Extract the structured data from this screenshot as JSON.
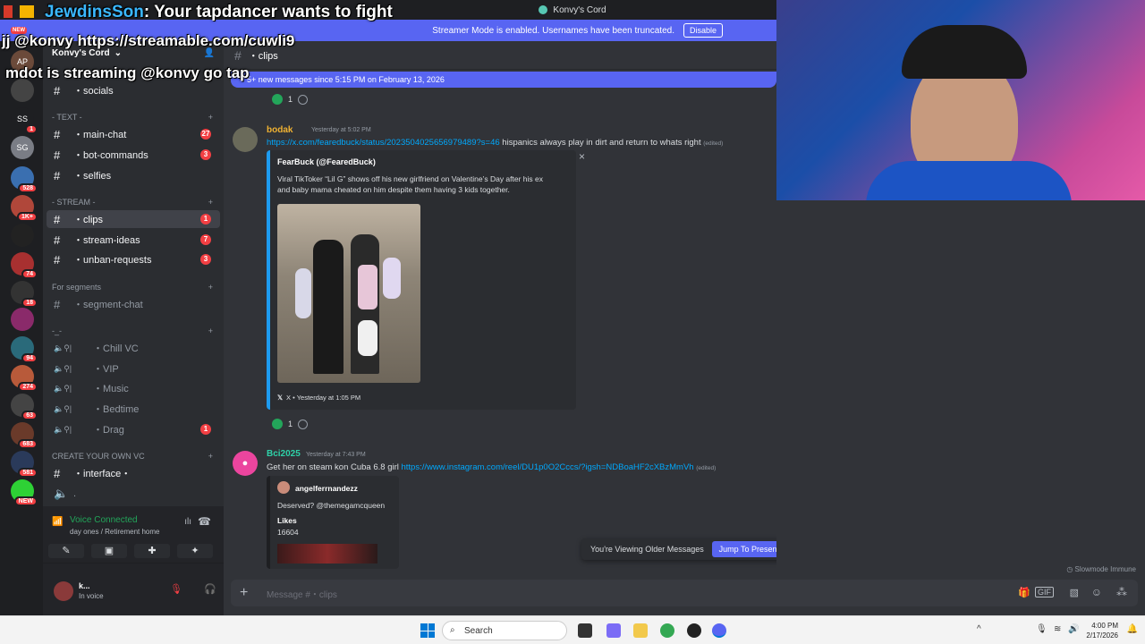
{
  "window": {
    "title": "Konvy's Cord"
  },
  "streamer": {
    "text": "Streamer Mode is enabled. Usernames have been truncated.",
    "disable": "Disable"
  },
  "overlay": {
    "line1_user": "JewdinsSon",
    "line1_text": ": Your tapdancer wants to fight",
    "line2": "jj @konvy https://streamable.com/cuwli9",
    "line3": "mdot is streaming @konvy go tap",
    "new_badge": "NEW"
  },
  "rail": {
    "servers": [
      {
        "label": "AP",
        "color": "#6b4a3a",
        "badge": ""
      },
      {
        "label": "",
        "color": "#444",
        "badge": ""
      },
      {
        "label": "SS",
        "color": "#1e1f22",
        "badge": "1"
      },
      {
        "label": "SG",
        "color": "#7a7d85",
        "badge": ""
      },
      {
        "label": "",
        "color": "#3a6fb0",
        "badge": "528"
      },
      {
        "label": "",
        "color": "#b0473a",
        "badge": "1K+"
      },
      {
        "label": "",
        "color": "#222",
        "badge": ""
      },
      {
        "label": "",
        "color": "#a83030",
        "badge": "74"
      },
      {
        "label": "",
        "color": "#333",
        "badge": "18"
      },
      {
        "label": "",
        "color": "#8a2a6a",
        "badge": ""
      },
      {
        "label": "",
        "color": "#2a6a7a",
        "badge": "94"
      },
      {
        "label": "",
        "color": "#b85a3a",
        "badge": "274"
      },
      {
        "label": "",
        "color": "#444",
        "badge": "63"
      },
      {
        "label": "",
        "color": "#6a3a2a",
        "badge": "683"
      },
      {
        "label": "",
        "color": "#2a3a5a",
        "badge": "581"
      },
      {
        "label": "",
        "color": "#2ed135",
        "badge": "NEW"
      }
    ]
  },
  "sidebar": {
    "server_name": "Konvy's Cord",
    "top_channel": "・socials",
    "cat_text": "- TEXT -",
    "cat_stream": "- STREAM -",
    "cat_segments": "For segments",
    "cat_voice": "-_-",
    "cat_create": "CREATE YOUR OWN VC",
    "channels": [
      {
        "name": "・main-chat",
        "count": "27"
      },
      {
        "name": "・bot-commands",
        "count": "3"
      },
      {
        "name": "・selfies",
        "count": ""
      },
      {
        "name": "・clips",
        "count": "1"
      },
      {
        "name": "・stream-ideas",
        "count": "7"
      },
      {
        "name": "・unban-requests",
        "count": "3"
      },
      {
        "name": "・segment-chat",
        "count": ""
      }
    ],
    "voice": [
      {
        "name": "・Chill VC",
        "count": ""
      },
      {
        "name": "・VIP",
        "count": ""
      },
      {
        "name": "・Music",
        "count": ""
      },
      {
        "name": "・Bedtime",
        "count": ""
      },
      {
        "name": "・Drag",
        "count": "1"
      }
    ],
    "interface": "・interface・",
    "last": ".",
    "voice_connected": "Voice Connected",
    "voice_sub": "day ones / Retirement home",
    "user_name": "k...",
    "user_status": "In voice"
  },
  "main": {
    "channel": "・clips",
    "new_messages": "5+ new messages since 5:15 PM on February 13, 2026",
    "reaction_count": "1",
    "msg1": {
      "author": "bodak",
      "author_color": "#f0b232",
      "ts": "Yesterday at 5:02 PM",
      "link": "https://x.com/fearedbuck/status/2023504025656979489?s=46",
      "text": " hispanics always play in dirt and return to whats right ",
      "edited": "(edited)",
      "embed_author": "FearBuck (@FearedBuck)",
      "embed_text1": "Viral TikToker “Lil G” shows off his new girlfriend on Valentine’s Day after his ex",
      "embed_text2": "and baby mama cheated on him despite them having 3 kids together.",
      "embed_footer": "X • Yesterday at 1:05 PM",
      "close": "×"
    },
    "msg2": {
      "author": "Bci2025",
      "author_color": "#2ed1a8",
      "ts": "Yesterday at 7:43 PM",
      "text": "Get her on steam kon Cuba 6.8 girl ",
      "link": "https://www.instagram.com/reel/DU1p0O2Cccs/?igsh=NDBoaHF2cXBzMmVh",
      "edited": "(edited)",
      "embed_author": "angelferrnandezz",
      "embed_text": "Deserved? @themegamcqueen",
      "likes_label": "Likes",
      "likes_value": "16604"
    },
    "jump": {
      "text": "You're Viewing Older Messages",
      "button": "Jump To Present"
    },
    "composer_placeholder": "Message #・clips",
    "slowmode": "Slowmode Immune"
  },
  "taskbar": {
    "search": "Search",
    "time": "4:00 PM",
    "date": "2/17/2026"
  }
}
